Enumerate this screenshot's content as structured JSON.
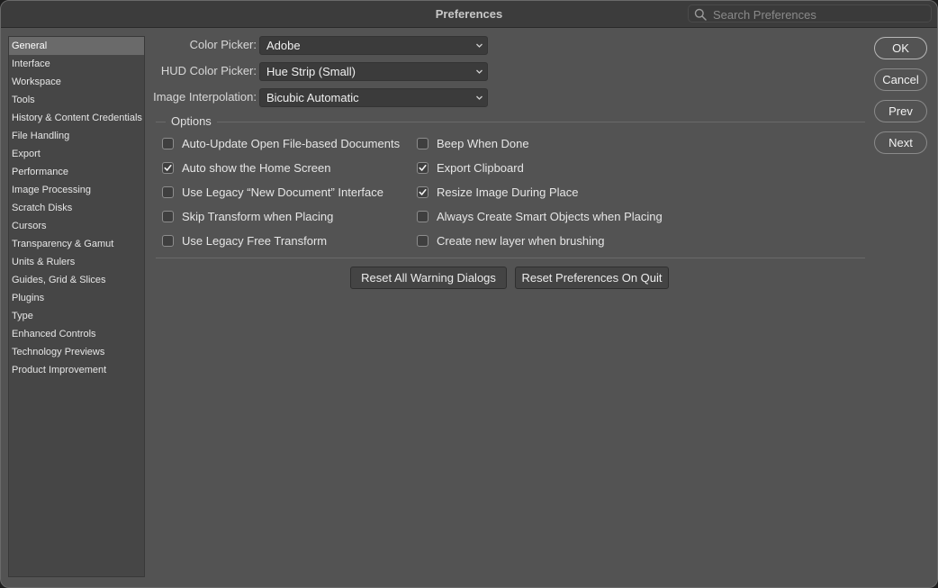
{
  "window": {
    "title": "Preferences"
  },
  "search": {
    "placeholder": "Search Preferences",
    "icon": "search-icon"
  },
  "sidebar": {
    "items": [
      {
        "label": "General",
        "selected": true
      },
      {
        "label": "Interface"
      },
      {
        "label": "Workspace"
      },
      {
        "label": "Tools"
      },
      {
        "label": "History & Content Credentials"
      },
      {
        "label": "File Handling"
      },
      {
        "label": "Export"
      },
      {
        "label": "Performance"
      },
      {
        "label": "Image Processing"
      },
      {
        "label": "Scratch Disks"
      },
      {
        "label": "Cursors"
      },
      {
        "label": "Transparency & Gamut"
      },
      {
        "label": "Units & Rulers"
      },
      {
        "label": "Guides, Grid & Slices"
      },
      {
        "label": "Plugins"
      },
      {
        "label": "Type"
      },
      {
        "label": "Enhanced Controls"
      },
      {
        "label": "Technology Previews"
      },
      {
        "label": "Product Improvement"
      }
    ]
  },
  "general": {
    "color_picker": {
      "label": "Color Picker:",
      "value": "Adobe"
    },
    "hud_color_picker": {
      "label": "HUD Color Picker:",
      "value": "Hue Strip (Small)"
    },
    "image_interpolation": {
      "label": "Image Interpolation:",
      "value": "Bicubic Automatic"
    },
    "options_label": "Options",
    "options_left": [
      {
        "label": "Auto-Update Open File-based Documents",
        "checked": false
      },
      {
        "label": "Auto show the Home Screen",
        "checked": true
      },
      {
        "label": "Use Legacy “New Document” Interface",
        "checked": false
      },
      {
        "label": "Skip Transform when Placing",
        "checked": false
      },
      {
        "label": "Use Legacy Free Transform",
        "checked": false
      }
    ],
    "options_right": [
      {
        "label": "Beep When Done",
        "checked": false
      },
      {
        "label": "Export Clipboard",
        "checked": true
      },
      {
        "label": "Resize Image During Place",
        "checked": true
      },
      {
        "label": "Always Create Smart Objects when Placing",
        "checked": false
      },
      {
        "label": "Create new layer when brushing",
        "checked": false
      }
    ],
    "reset_warnings_label": "Reset All Warning Dialogs",
    "reset_prefs_label": "Reset Preferences On Quit"
  },
  "actions": {
    "ok": "OK",
    "cancel": "Cancel",
    "prev": "Prev",
    "next": "Next"
  }
}
